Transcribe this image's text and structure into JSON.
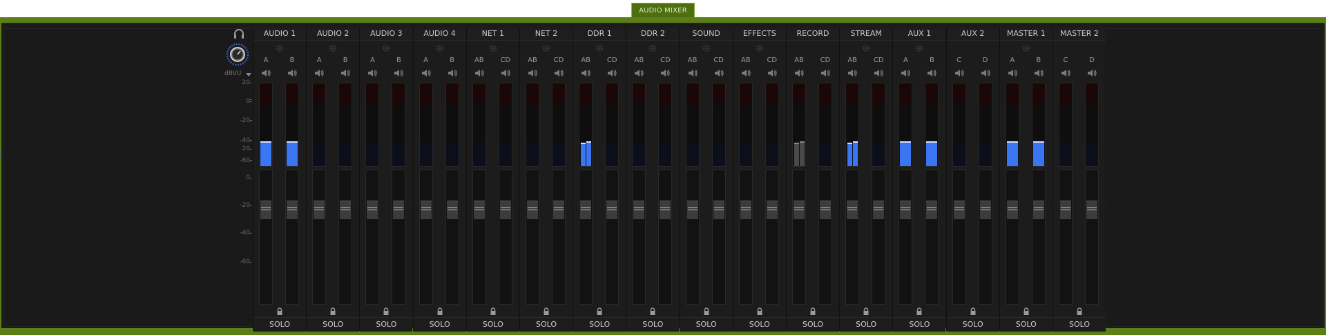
{
  "tab": {
    "label": "AUDIO MIXER"
  },
  "colors": {
    "accent_green": "#5b7f16",
    "meter_blue": "#3b76f2",
    "panel_bg": "#1b1b1b"
  },
  "scale": {
    "unit_label": "dBVU",
    "meter_labels": [
      "20",
      "0",
      "-20",
      "-40",
      "-60"
    ],
    "fader_labels": [
      "20",
      "0",
      "-20",
      "-40",
      "-60"
    ]
  },
  "solo_label": "SOLO",
  "channels": [
    {
      "name": "AUDIO 1",
      "labels": [
        "A",
        "B"
      ],
      "levels": [
        0.3,
        0.3
      ],
      "style": "blue",
      "gear": true
    },
    {
      "name": "AUDIO 2",
      "labels": [
        "A",
        "B"
      ],
      "levels": [
        0,
        0
      ],
      "style": "blue",
      "gear": true
    },
    {
      "name": "AUDIO 3",
      "labels": [
        "A",
        "B"
      ],
      "levels": [
        0,
        0
      ],
      "style": "blue",
      "gear": true
    },
    {
      "name": "AUDIO 4",
      "labels": [
        "A",
        "B"
      ],
      "levels": [
        0,
        0
      ],
      "style": "blue",
      "gear": true
    },
    {
      "name": "NET 1",
      "labels": [
        "AB",
        "CD"
      ],
      "levels": [
        0,
        0
      ],
      "style": "blue",
      "gear": true
    },
    {
      "name": "NET 2",
      "labels": [
        "AB",
        "CD"
      ],
      "levels": [
        0,
        0
      ],
      "style": "blue",
      "gear": true
    },
    {
      "name": "DDR 1",
      "labels": [
        "AB",
        "CD"
      ],
      "levels": [
        0.3,
        0
      ],
      "split": true,
      "style": "blue",
      "gear": true
    },
    {
      "name": "DDR 2",
      "labels": [
        "AB",
        "CD"
      ],
      "levels": [
        0,
        0
      ],
      "style": "blue",
      "gear": true
    },
    {
      "name": "SOUND",
      "labels": [
        "AB",
        "CD"
      ],
      "levels": [
        0,
        0
      ],
      "style": "blue",
      "gear": true
    },
    {
      "name": "EFFECTS",
      "labels": [
        "AB",
        "CD"
      ],
      "levels": [
        0,
        0
      ],
      "style": "blue",
      "gear": true
    },
    {
      "name": "RECORD",
      "labels": [
        "AB",
        "CD"
      ],
      "levels": [
        0.3,
        0
      ],
      "split": true,
      "style": "grey",
      "gear": false
    },
    {
      "name": "STREAM",
      "labels": [
        "AB",
        "CD"
      ],
      "levels": [
        0.3,
        0
      ],
      "split": true,
      "style": "blue",
      "gear": true
    },
    {
      "name": "AUX 1",
      "labels": [
        "A",
        "B"
      ],
      "levels": [
        0.3,
        0.3
      ],
      "style": "blue",
      "gear": true
    },
    {
      "name": "AUX 2",
      "labels": [
        "C",
        "D"
      ],
      "levels": [
        0,
        0
      ],
      "style": "blue",
      "gear": false
    },
    {
      "name": "MASTER 1",
      "labels": [
        "A",
        "B"
      ],
      "levels": [
        0.3,
        0.3
      ],
      "style": "blue",
      "gear": true
    },
    {
      "name": "MASTER 2",
      "labels": [
        "C",
        "D"
      ],
      "levels": [
        0,
        0
      ],
      "style": "blue",
      "gear": false
    }
  ]
}
